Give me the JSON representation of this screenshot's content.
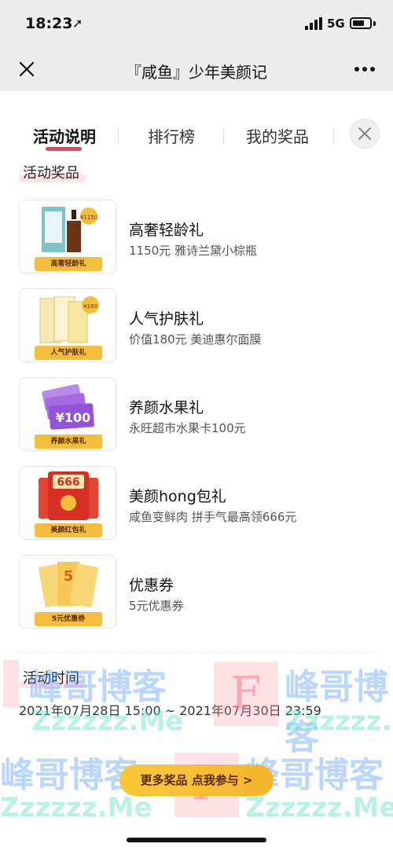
{
  "status_bar": {
    "time": "18:23",
    "network": "5G"
  },
  "nav": {
    "title": "『咸鱼』少年美颜记"
  },
  "tabs": [
    {
      "label": "活动说明",
      "active": true
    },
    {
      "label": "排行榜",
      "active": false
    },
    {
      "label": "我的奖品",
      "active": false
    }
  ],
  "prizes_section": {
    "label": "活动奖品"
  },
  "prizes": [
    {
      "title": "高奢轻龄礼",
      "description": "1150元 雅诗兰黛小棕瓶",
      "thumb_label": "高奢轻龄礼",
      "thumb_badge": "¥1150"
    },
    {
      "title": "人气护肤礼",
      "description": "价值180元 美迪惠尔面膜",
      "thumb_label": "人气护肤礼",
      "thumb_badge": "¥180"
    },
    {
      "title": "养颜水果礼",
      "description": "永旺超市水果卡100元",
      "thumb_label": "养颜水果礼",
      "thumb_badge": "¥100"
    },
    {
      "title": "美颜hong包礼",
      "description": "咸鱼变鲜肉   拼手气最高领666元",
      "thumb_label": "美颜红包礼",
      "thumb_badge": "666"
    },
    {
      "title": "优惠券",
      "description": "5元优惠券",
      "thumb_label": "5元优惠券",
      "thumb_badge": "5"
    }
  ],
  "time_section": {
    "label": "活动时间",
    "range": "2021年07月28日 15:00 ~ 2021年07月30日 23:59"
  },
  "cta": {
    "label": "更多奖品  点我参与 >"
  },
  "watermark": {
    "cn": "峰哥博客",
    "en": "Zzzzzz.Me",
    "letter": "F"
  },
  "colors": {
    "accent": "#e9435a",
    "cta": "#f5b530",
    "nav_bg": "#ededed"
  }
}
